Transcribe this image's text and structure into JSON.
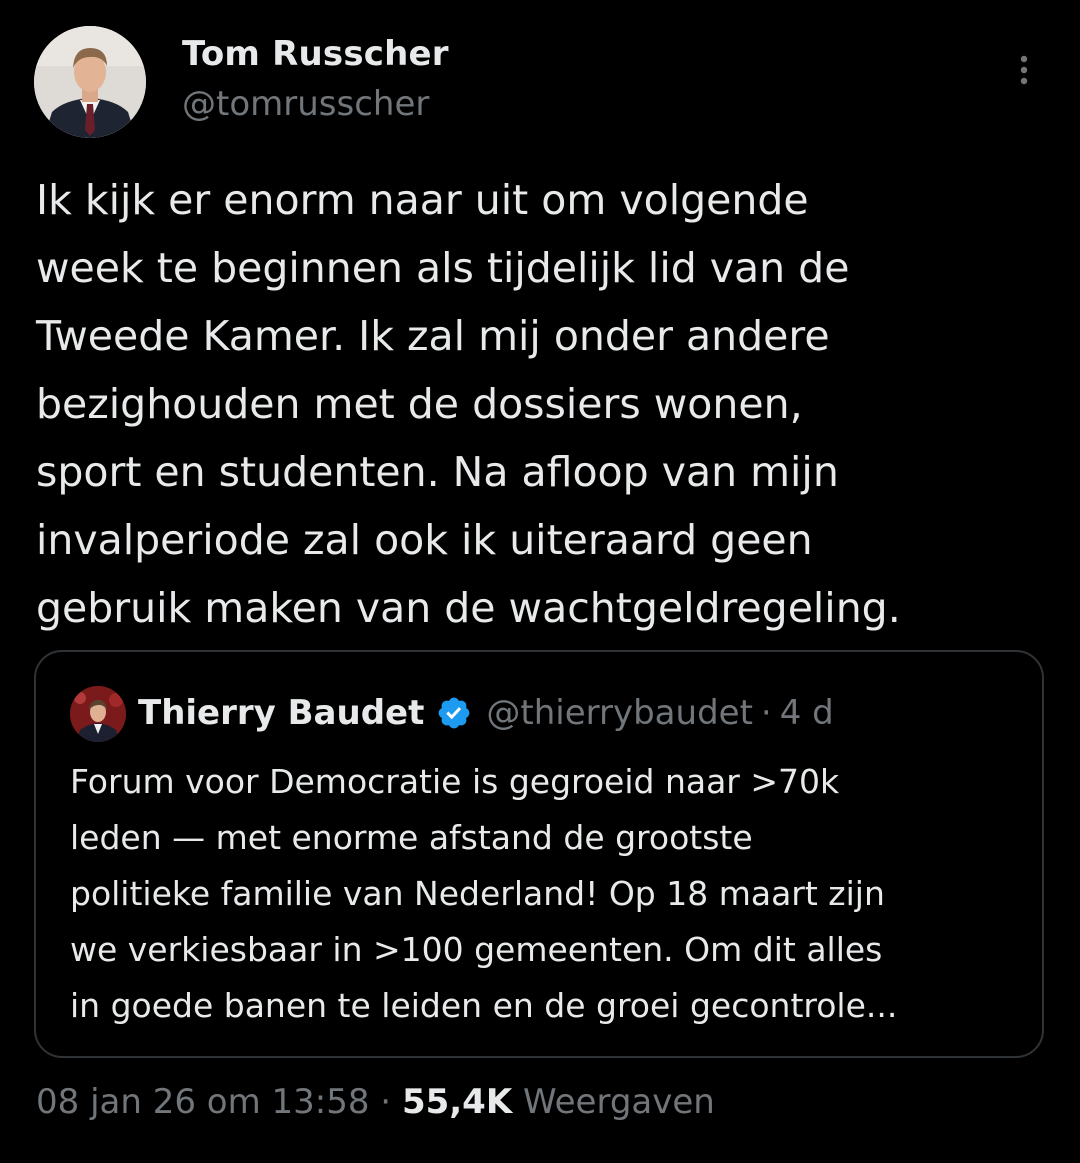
{
  "author": {
    "name": "Tom Russcher",
    "handle": "@tomrusscher"
  },
  "tweet": {
    "lines": [
      "Ik kijk er enorm naar uit om volgende",
      "week te beginnen als tijdelijk lid van de",
      "Tweede Kamer. Ik zal mij onder andere",
      "bezighouden met de dossiers wonen,",
      "sport en studenten. Na afloop van mijn",
      "invalperiode zal ook ik uiteraard geen",
      "gebruik maken van de wachtgeldregeling."
    ]
  },
  "quoted_tweet": {
    "name": "Thierry Baudet",
    "verified": true,
    "handle": "@thierrybaudet",
    "separator": "·",
    "time": "4 d",
    "lines": [
      "Forum voor Democratie is gegroeid naar >70k",
      "leden — met enorme afstand de grootste",
      "politieke familie van Nederland! Op 18 maart zijn",
      "we verkiesbaar in >100 gemeenten. Om dit alles",
      "in goede banen te leiden en de groei gecontrole..."
    ]
  },
  "meta": {
    "timestamp": "08 jan 26 om 13:58",
    "separator": " · ",
    "views_count": "55,4K",
    "views_label": " Weergaven"
  },
  "icons": {
    "more": "more-vertical-icon",
    "verified": "verified-badge-icon"
  },
  "colors": {
    "background": "#000000",
    "text_primary": "#e7e9ea",
    "text_secondary": "#71767b",
    "border": "#2f3336",
    "verified": "#1d9bf0"
  }
}
